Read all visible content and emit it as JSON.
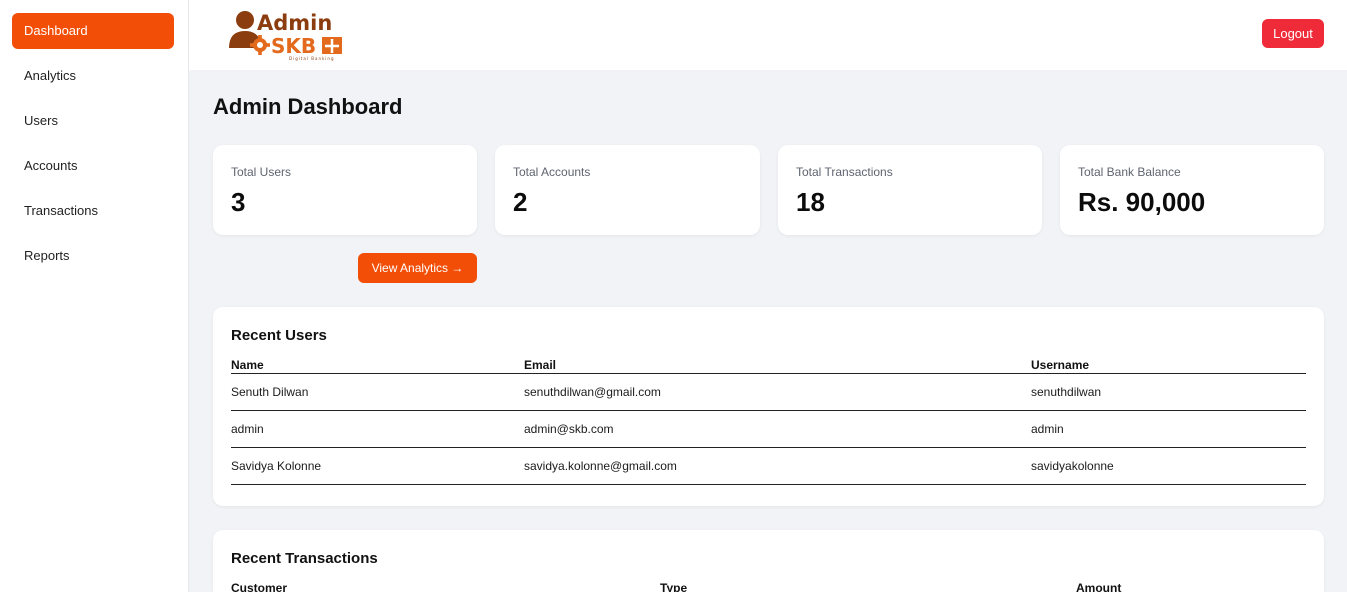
{
  "sidebar": {
    "items": [
      {
        "label": "Dashboard"
      },
      {
        "label": "Analytics"
      },
      {
        "label": "Users"
      },
      {
        "label": "Accounts"
      },
      {
        "label": "Transactions"
      },
      {
        "label": "Reports"
      }
    ],
    "active": "Dashboard"
  },
  "header": {
    "logo": {
      "line1": "Admin",
      "line2": "SKB",
      "tagline": "Digital Banking"
    },
    "logout_label": "Logout"
  },
  "main": {
    "title": "Admin Dashboard",
    "stats": [
      {
        "label": "Total Users",
        "value": "3"
      },
      {
        "label": "Total Accounts",
        "value": "2"
      },
      {
        "label": "Total Transactions",
        "value": "18"
      },
      {
        "label": "Total Bank Balance",
        "value": "Rs. 90,000"
      }
    ],
    "view_analytics_label": "View Analytics →",
    "recent_users": {
      "title": "Recent Users",
      "columns": [
        "Name",
        "Email",
        "Username"
      ],
      "rows": [
        [
          "Senuth Dilwan",
          "senuthdilwan@gmail.com",
          "senuthdilwan"
        ],
        [
          "admin",
          "admin@skb.com",
          "admin"
        ],
        [
          "Savidya Kolonne",
          "savidya.kolonne@gmail.com",
          "savidyakolonne"
        ]
      ]
    },
    "recent_transactions": {
      "title": "Recent Transactions",
      "columns": [
        "Customer",
        "Type",
        "Amount"
      ]
    }
  },
  "colors": {
    "accent": "#f24e07",
    "logout": "#ef2b39",
    "logo_brown": "#8b3d10",
    "background": "#f1f3f7"
  }
}
